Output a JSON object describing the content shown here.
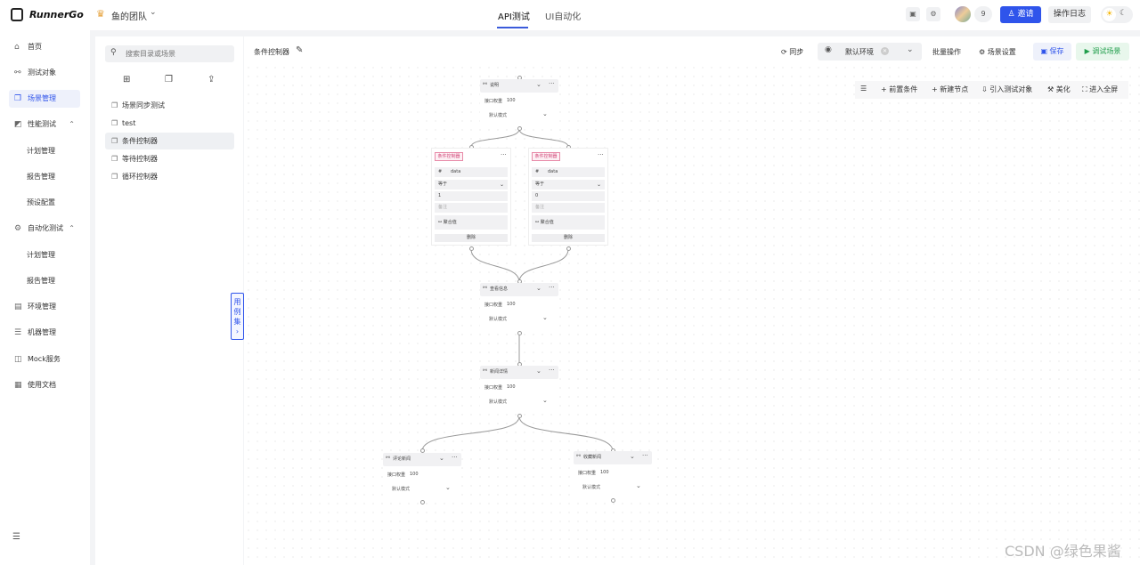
{
  "topbar": {
    "logo": "RunnerGo",
    "team": "鱼的团队",
    "tabs": [
      "API测试",
      "UI自动化"
    ],
    "member_count": "9",
    "invite": "邀请",
    "operation_log": "操作日志"
  },
  "sidebar": {
    "items": [
      {
        "label": "首页",
        "icon": "home-icon"
      },
      {
        "label": "测试对象",
        "icon": "link-icon"
      },
      {
        "label": "场景管理",
        "icon": "scene-icon"
      },
      {
        "label": "性能测试",
        "icon": "chart-icon"
      },
      {
        "label": "计划管理"
      },
      {
        "label": "报告管理"
      },
      {
        "label": "预设配置"
      },
      {
        "label": "自动化测试",
        "icon": "gear-icon"
      },
      {
        "label": "计划管理"
      },
      {
        "label": "报告管理"
      },
      {
        "label": "环境管理",
        "icon": "env-icon"
      },
      {
        "label": "机器管理",
        "icon": "machine-icon"
      },
      {
        "label": "Mock服务",
        "icon": "mock-icon"
      },
      {
        "label": "使用文档",
        "icon": "doc-icon"
      }
    ]
  },
  "tree": {
    "search_placeholder": "搜索目录或场景",
    "items": [
      "场景同步测试",
      "test",
      "条件控制器",
      "等待控制器",
      "循环控制器"
    ],
    "case_tab": [
      "用",
      "例",
      "集"
    ]
  },
  "canvas": {
    "title": "条件控制器",
    "sync": "同步",
    "env": "默认环境",
    "batch": "批量操作",
    "scene_settings": "场景设置",
    "save": "保存",
    "debug": "调试场景",
    "toolbar": [
      "前置条件",
      "新建节点",
      "引入测试对象",
      "美化",
      "进入全屏"
    ],
    "nodes": {
      "weight_label": "接口权重",
      "weight_value": "100",
      "mode": "默认模式",
      "api": [
        "说明",
        "查看信息",
        "新闻详情",
        "评论新闻",
        "收藏新闻"
      ],
      "cond": [
        {
          "tag": "条件控制器",
          "op_icon": "#",
          "var": "data",
          "op": "等于",
          "value": "1",
          "remark": "备注",
          "aggregate": "聚合值",
          "delete": "删除"
        },
        {
          "tag": "条件控制器",
          "op_icon": "#",
          "var": "data",
          "op": "等于",
          "value": "0",
          "remark": "备注",
          "aggregate": "聚合值",
          "delete": "删除"
        }
      ]
    }
  },
  "watermark": "CSDN @绿色果酱"
}
